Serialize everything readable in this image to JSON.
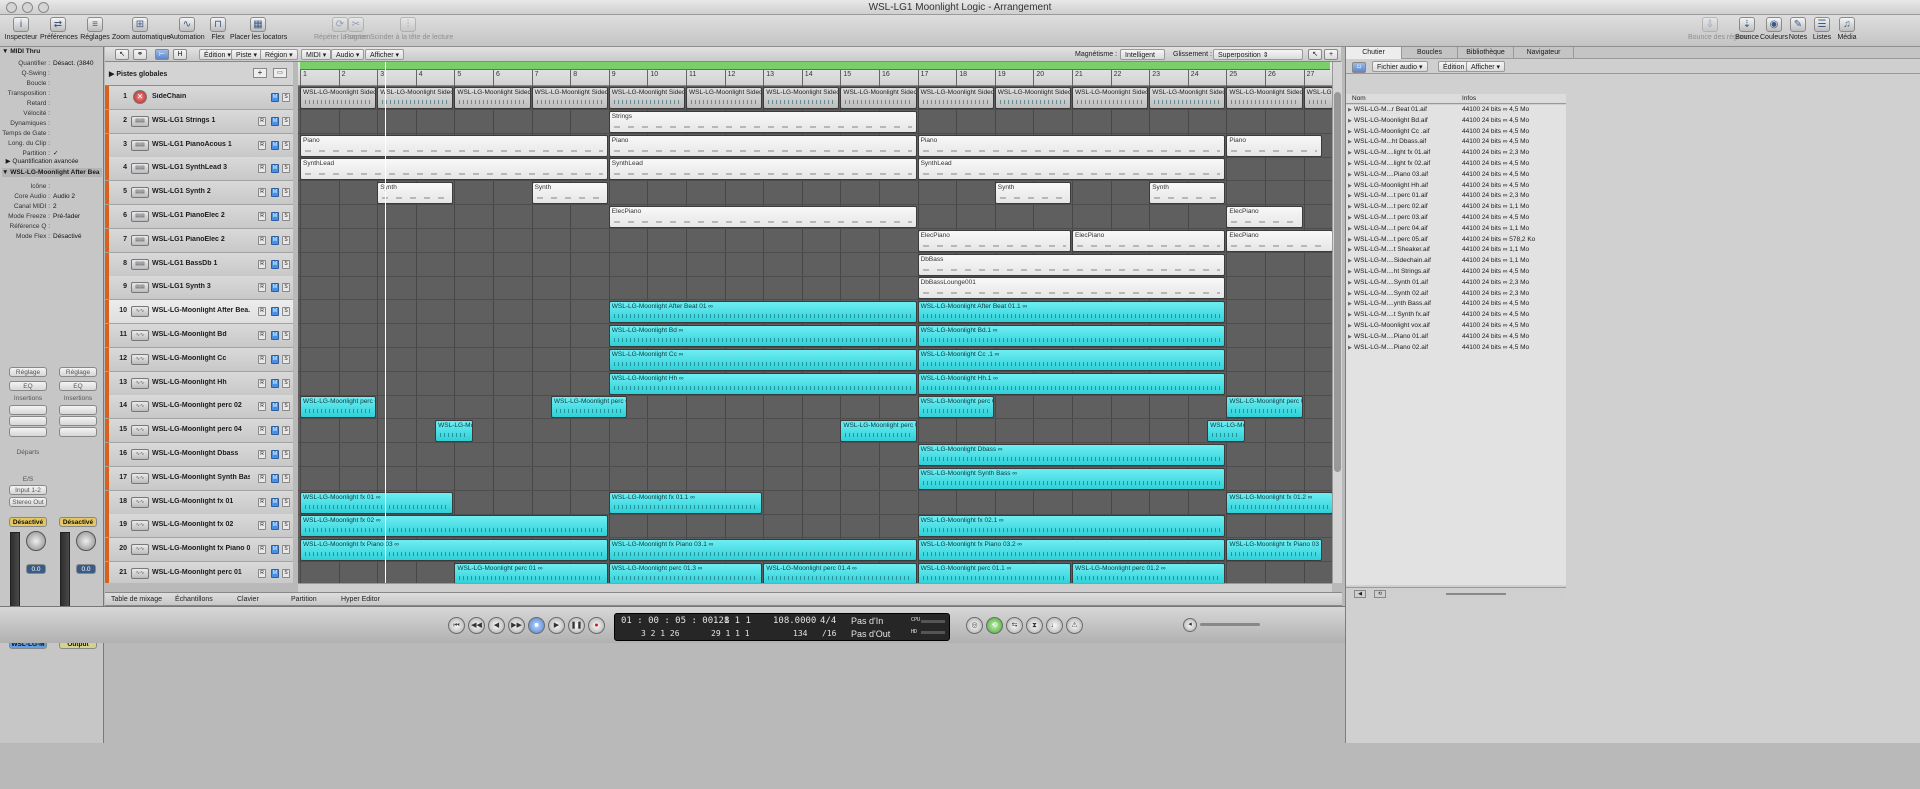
{
  "window_title": "WSL-LG1 Moonlight Logic - Arrangement",
  "toolbar": {
    "left": [
      {
        "label": "Inspecteur",
        "icon": "info-icon",
        "glyph": "i"
      },
      {
        "label": "Préférences",
        "icon": "switch-icon",
        "glyph": "⇄"
      },
      {
        "label": "Réglages",
        "icon": "sliders-icon",
        "glyph": "≡"
      },
      {
        "label": "Zoom automatique",
        "icon": "zoom-icon",
        "glyph": "⊞"
      },
      {
        "label": "Automation",
        "icon": "automation-icon",
        "glyph": "∿"
      },
      {
        "label": "Flex",
        "icon": "flex-icon",
        "glyph": "⊓"
      },
      {
        "label": "Placer les locators",
        "icon": "locators-icon",
        "glyph": "▦"
      },
      {
        "label": "Répéter la section",
        "icon": "repeat-icon",
        "glyph": "⟳",
        "dim": true
      },
      {
        "label": "Rogner",
        "icon": "crop-icon",
        "glyph": "✂",
        "dim": true
      },
      {
        "label": "Scinder à la tête de lecture",
        "icon": "split-icon",
        "glyph": "⫶",
        "dim": true
      }
    ],
    "right": [
      {
        "label": "Bounce des régions",
        "icon": "bounce-regions-icon",
        "glyph": "⇩",
        "dim": true
      },
      {
        "label": "Bounce",
        "icon": "bounce-icon",
        "glyph": "⇣"
      },
      {
        "label": "Couleurs",
        "icon": "colors-icon",
        "glyph": "◉"
      },
      {
        "label": "Notes",
        "icon": "notes-icon",
        "glyph": "✎"
      },
      {
        "label": "Listes",
        "icon": "lists-icon",
        "glyph": "☰"
      },
      {
        "label": "Média",
        "icon": "media-icon",
        "glyph": "♫"
      }
    ]
  },
  "inspector": {
    "midi_thru": "MIDI Thru",
    "params": [
      {
        "k": "Quantifier",
        "v": "Désact. (3840"
      },
      {
        "k": "Q-Swing",
        "v": ""
      },
      {
        "k": "Boucle",
        "v": ""
      },
      {
        "k": "Transposition",
        "v": ""
      },
      {
        "k": "Retard",
        "v": ""
      },
      {
        "k": "Vélocité",
        "v": ""
      },
      {
        "k": "Dynamiques",
        "v": ""
      },
      {
        "k": "Temps de Gate",
        "v": ""
      },
      {
        "k": "Long. du Clip",
        "v": ""
      },
      {
        "k": "Partition",
        "v": "✓"
      }
    ],
    "advanced": "Quantification avancée",
    "track_header": "WSL-LG-Moonlight After Bea",
    "track_params": [
      {
        "k": "Icône",
        "v": ""
      },
      {
        "k": "Core Audio",
        "v": "Audio 2"
      },
      {
        "k": "Canal MIDI",
        "v": "2"
      },
      {
        "k": "Mode Freeze",
        "v": "Pré-fader"
      },
      {
        "k": "Référence Q",
        "v": ""
      },
      {
        "k": "Mode Flex",
        "v": "Désactivé"
      }
    ],
    "strips": [
      {
        "reglage": "Réglage",
        "eq": "EQ",
        "insertions": "Insertions",
        "departs": "Départs",
        "es": "E/S",
        "input": "Input 1-2",
        "output": "Stereo Out",
        "mode": "Désactivé",
        "value": "0.0",
        "name": "WSL-LG-M"
      },
      {
        "reglage": "Réglage",
        "eq": "EQ",
        "insertions": "Insertions",
        "departs": "",
        "es": "",
        "input": "",
        "output": "",
        "mode": "Désactivé",
        "value": "0.0",
        "name": "Output",
        "bnce": "Bnce"
      }
    ]
  },
  "arrange_menu": {
    "items": [
      "Édition",
      "Piste",
      "Région",
      "MIDI",
      "Audio",
      "Afficher"
    ],
    "magnet_label": "Magnétisme :",
    "magnet_value": "Intelligent",
    "drag_label": "Glissement :",
    "drag_value": "Superposition",
    "globals_label": "Pistes globales"
  },
  "ruler": [
    "1",
    "2",
    "3",
    "4",
    "5",
    "6",
    "7",
    "8",
    "9",
    "10",
    "11",
    "12",
    "13",
    "14",
    "15",
    "16",
    "17",
    "18",
    "19",
    "20",
    "21",
    "22",
    "23",
    "24",
    "25",
    "26",
    "27"
  ],
  "tracks": [
    {
      "n": "1",
      "name": "SideChain",
      "type": "side"
    },
    {
      "n": "2",
      "name": "WSL-LG1 Strings 1",
      "type": "midi"
    },
    {
      "n": "3",
      "name": "WSL-LG1 PianoAcous 1",
      "type": "midi"
    },
    {
      "n": "4",
      "name": "WSL-LG1 SynthLead 3",
      "type": "midi"
    },
    {
      "n": "5",
      "name": "WSL-LG1 Synth 2",
      "type": "midi"
    },
    {
      "n": "6",
      "name": "WSL-LG1 PianoElec 2",
      "type": "midi"
    },
    {
      "n": "7",
      "name": "WSL-LG1 PianoElec 2",
      "type": "midi"
    },
    {
      "n": "8",
      "name": "WSL-LG1 BassDb 1",
      "type": "midi"
    },
    {
      "n": "9",
      "name": "WSL-LG1 Synth 3",
      "type": "midi"
    },
    {
      "n": "10",
      "name": "WSL-LG-Moonlight After Bea...",
      "type": "audio",
      "sel": true
    },
    {
      "n": "11",
      "name": "WSL-LG-Moonlight Bd",
      "type": "audio"
    },
    {
      "n": "12",
      "name": "WSL-LG-Moonlight Cc",
      "type": "audio"
    },
    {
      "n": "13",
      "name": "WSL-LG-Moonlight Hh",
      "type": "audio"
    },
    {
      "n": "14",
      "name": "WSL-LG-Moonlight perc 02",
      "type": "audio"
    },
    {
      "n": "15",
      "name": "WSL-LG-Moonlight perc 04",
      "type": "audio"
    },
    {
      "n": "16",
      "name": "WSL-LG-Moonlight Dbass",
      "type": "audio"
    },
    {
      "n": "17",
      "name": "WSL-LG-Moonlight Synth Bass",
      "type": "audio"
    },
    {
      "n": "18",
      "name": "WSL-LG-Moonlight fx 01",
      "type": "audio"
    },
    {
      "n": "19",
      "name": "WSL-LG-Moonlight fx 02",
      "type": "audio"
    },
    {
      "n": "20",
      "name": "WSL-LG-Moonlight fx Piano 03",
      "type": "audio"
    },
    {
      "n": "21",
      "name": "WSL-LG-Moonlight perc 01",
      "type": "audio"
    }
  ],
  "regions": [
    [
      {
        "s": 1,
        "e": 3,
        "t": "WSL-LG-Moonlight Sidech",
        "k": "side"
      },
      {
        "s": 3,
        "e": 5,
        "t": "WSL-LG-Moonlight Sidech",
        "k": "side"
      },
      {
        "s": 5,
        "e": 7,
        "t": "WSL-LG-Moonlight Sidech",
        "k": "side"
      },
      {
        "s": 7,
        "e": 9,
        "t": "WSL-LG-Moonlight Sidech",
        "k": "side"
      },
      {
        "s": 9,
        "e": 11,
        "t": "WSL-LG-Moonlight Sidech",
        "k": "side"
      },
      {
        "s": 11,
        "e": 13,
        "t": "WSL-LG-Moonlight Sidech",
        "k": "side"
      },
      {
        "s": 13,
        "e": 15,
        "t": "WSL-LG-Moonlight Sidech",
        "k": "side"
      },
      {
        "s": 15,
        "e": 17,
        "t": "WSL-LG-Moonlight Sidech",
        "k": "side"
      },
      {
        "s": 17,
        "e": 19,
        "t": "WSL-LG-Moonlight Sidech",
        "k": "side"
      },
      {
        "s": 19,
        "e": 21,
        "t": "WSL-LG-Moonlight Sidech",
        "k": "side"
      },
      {
        "s": 21,
        "e": 23,
        "t": "WSL-LG-Moonlight Sidech",
        "k": "side"
      },
      {
        "s": 23,
        "e": 25,
        "t": "WSL-LG-Moonlight Sidech",
        "k": "side"
      },
      {
        "s": 25,
        "e": 27,
        "t": "WSL-LG-Moonlight Sidech",
        "k": "side"
      },
      {
        "s": 27,
        "e": 27.8,
        "t": "WSL-LG-",
        "k": "side"
      }
    ],
    [
      {
        "s": 9,
        "e": 17,
        "t": "Strings",
        "k": "midi"
      }
    ],
    [
      {
        "s": 1,
        "e": 9,
        "t": "Piano",
        "k": "midi"
      },
      {
        "s": 9,
        "e": 17,
        "t": "Piano",
        "k": "midi"
      },
      {
        "s": 17,
        "e": 25,
        "t": "Piano",
        "k": "midi"
      },
      {
        "s": 25,
        "e": 27.5,
        "t": "Piano",
        "k": "midi"
      }
    ],
    [
      {
        "s": 1,
        "e": 9,
        "t": "SynthLead",
        "k": "midi"
      },
      {
        "s": 9,
        "e": 17,
        "t": "SynthLead",
        "k": "midi"
      },
      {
        "s": 17,
        "e": 25,
        "t": "SynthLead",
        "k": "midi"
      }
    ],
    [
      {
        "s": 3,
        "e": 5,
        "t": "Synth",
        "k": "midi"
      },
      {
        "s": 7,
        "e": 9,
        "t": "Synth",
        "k": "midi"
      },
      {
        "s": 19,
        "e": 21,
        "t": "Synth",
        "k": "midi"
      },
      {
        "s": 23,
        "e": 25,
        "t": "Synth",
        "k": "midi"
      }
    ],
    [
      {
        "s": 9,
        "e": 17,
        "t": "ElecPiano",
        "k": "midi"
      },
      {
        "s": 25,
        "e": 27,
        "t": "ElecPiano",
        "k": "midi"
      }
    ],
    [
      {
        "s": 17,
        "e": 21,
        "t": "ElecPiano",
        "k": "midi"
      },
      {
        "s": 21,
        "e": 25,
        "t": "ElecPiano",
        "k": "midi"
      },
      {
        "s": 25,
        "e": 27.8,
        "t": "ElecPiano",
        "k": "midi"
      }
    ],
    [
      {
        "s": 17,
        "e": 25,
        "t": "DbBass",
        "k": "midi"
      }
    ],
    [
      {
        "s": 17,
        "e": 25,
        "t": "DbBassLounge001",
        "k": "midi"
      }
    ],
    [
      {
        "s": 9,
        "e": 17,
        "t": "WSL-LG-Moonlight After Beat 01 ∞",
        "k": "audio"
      },
      {
        "s": 17,
        "e": 25,
        "t": "WSL-LG-Moonlight After Beat 01.1 ∞",
        "k": "audio"
      }
    ],
    [
      {
        "s": 9,
        "e": 17,
        "t": "WSL-LG-Moonlight Bd ∞",
        "k": "audio"
      },
      {
        "s": 17,
        "e": 25,
        "t": "WSL-LG-Moonlight Bd.1 ∞",
        "k": "audio"
      }
    ],
    [
      {
        "s": 9,
        "e": 17,
        "t": "WSL-LG-Moonlight Cc ∞",
        "k": "audio"
      },
      {
        "s": 17,
        "e": 25,
        "t": "WSL-LG-Moonlight Cc .1 ∞",
        "k": "audio"
      }
    ],
    [
      {
        "s": 9,
        "e": 17,
        "t": "WSL-LG-Moonlight Hh ∞",
        "k": "audio"
      },
      {
        "s": 17,
        "e": 25,
        "t": "WSL-LG-Moonlight Hh.1 ∞",
        "k": "audio"
      }
    ],
    [
      {
        "s": 1,
        "e": 3,
        "t": "WSL-LG-Moonlight perc 0",
        "k": "audio"
      },
      {
        "s": 7.5,
        "e": 9.5,
        "t": "WSL-LG-Moonlight perc 0",
        "k": "audio"
      },
      {
        "s": 17,
        "e": 19,
        "t": "WSL-LG-Moonlight perc 0",
        "k": "audio"
      },
      {
        "s": 25,
        "e": 27,
        "t": "WSL-LG-Moonlight perc 0",
        "k": "audio"
      }
    ],
    [
      {
        "s": 4.5,
        "e": 5.5,
        "t": "WSL-LG-Mo",
        "k": "audio"
      },
      {
        "s": 15,
        "e": 17,
        "t": "WSL-LG-Moonlight perc 0",
        "k": "audio"
      },
      {
        "s": 24.5,
        "e": 25.5,
        "t": "WSL-LG-Mo",
        "k": "audio"
      }
    ],
    [
      {
        "s": 17,
        "e": 25,
        "t": "WSL-LG-Moonlight Dbass ∞",
        "k": "audio"
      }
    ],
    [
      {
        "s": 17,
        "e": 25,
        "t": "WSL-LG-Moonlight Synth Bass ∞",
        "k": "audio"
      }
    ],
    [
      {
        "s": 1,
        "e": 5,
        "t": "WSL-LG-Moonlight fx 01 ∞",
        "k": "audio"
      },
      {
        "s": 9,
        "e": 13,
        "t": "WSL-LG-Moonlight fx 01.1 ∞",
        "k": "audio"
      },
      {
        "s": 25,
        "e": 27.8,
        "t": "WSL-LG-Moonlight fx 01.2 ∞",
        "k": "audio"
      }
    ],
    [
      {
        "s": 1,
        "e": 9,
        "t": "WSL-LG-Moonlight fx 02 ∞",
        "k": "audio"
      },
      {
        "s": 17,
        "e": 25,
        "t": "WSL-LG-Moonlight fx 02.1 ∞",
        "k": "audio"
      }
    ],
    [
      {
        "s": 1,
        "e": 9,
        "t": "WSL-LG-Moonlight fx Piano 03 ∞",
        "k": "audio"
      },
      {
        "s": 9,
        "e": 17,
        "t": "WSL-LG-Moonlight fx Piano 03.1 ∞",
        "k": "audio"
      },
      {
        "s": 17,
        "e": 25,
        "t": "WSL-LG-Moonlight fx Piano 03.2 ∞",
        "k": "audio"
      },
      {
        "s": 25,
        "e": 27.5,
        "t": "WSL-LG-Moonlight fx Piano 03",
        "k": "audio"
      }
    ],
    [
      {
        "s": 5,
        "e": 9,
        "t": "WSL-LG-Moonlight perc 01 ∞",
        "k": "audio"
      },
      {
        "s": 9,
        "e": 13,
        "t": "WSL-LG-Moonlight perc 01.3 ∞",
        "k": "audio"
      },
      {
        "s": 13,
        "e": 17,
        "t": "WSL-LG-Moonlight perc 01.4 ∞",
        "k": "audio"
      },
      {
        "s": 17,
        "e": 21,
        "t": "WSL-LG-Moonlight perc 01.1 ∞",
        "k": "audio"
      },
      {
        "s": 21,
        "e": 25,
        "t": "WSL-LG-Moonlight perc 01.2 ∞",
        "k": "audio"
      }
    ]
  ],
  "bottom_tabs": [
    "Table de mixage",
    "Échantillons",
    "Clavier",
    "Partition",
    "Hyper Editor"
  ],
  "transport": {
    "smpte": "01 : 00 : 05 : 00.28",
    "smpte_sub": "3   2   1   26",
    "bars": "1   1   1   1",
    "bars_sub": "29   1   1   1",
    "tempo": "108.0000",
    "tempo_sub": "134",
    "sig": "4/4",
    "sig_sub": "/16",
    "in": "Pas d'In",
    "out": "Pas d'Out",
    "cpu": "CPU",
    "hd": "HD",
    "buttons": [
      "goto-start",
      "rewind",
      "rewind-fast",
      "forward-fast",
      "stop",
      "play",
      "pause",
      "record"
    ],
    "glyphs": [
      "⏮",
      "◀◀",
      "◀",
      "▶▶",
      "■",
      "▶",
      "❚❚",
      "●"
    ]
  },
  "media": {
    "tabs": [
      "Chutier",
      "Boucles",
      "Bibliothèque",
      "Navigateur"
    ],
    "menu": [
      "Fichier audio",
      "Édition",
      "Afficher"
    ],
    "col_name": "Nom",
    "col_info": "Infos",
    "files": [
      {
        "n": "WSL-LG-M...r Beat 01.aif",
        "i": "44100  24 bits  ∞  4,5 Mo"
      },
      {
        "n": "WSL-LG-Moonlight Bd.aif",
        "i": "44100  24 bits  ∞  4,5 Mo"
      },
      {
        "n": "WSL-LG-Moonlight Cc .aif",
        "i": "44100  24 bits  ∞  4,5 Mo"
      },
      {
        "n": "WSL-LG-M...ht Dbass.aif",
        "i": "44100  24 bits  ∞  4,5 Mo"
      },
      {
        "n": "WSL-LG-M....light fx 01.aif",
        "i": "44100  24 bits  ∞  2,3 Mo"
      },
      {
        "n": "WSL-LG-M....light fx 02.aif",
        "i": "44100  24 bits  ∞  4,5 Mo"
      },
      {
        "n": "WSL-LG-M....Piano 03.aif",
        "i": "44100  24 bits  ∞  4,5 Mo"
      },
      {
        "n": "WSL-LG-Moonlight Hh.aif",
        "i": "44100  24 bits  ∞  4,5 Mo"
      },
      {
        "n": "WSL-LG-M....t perc 01.aif",
        "i": "44100  24 bits  ∞  2,3 Mo"
      },
      {
        "n": "WSL-LG-M....t perc 02.aif",
        "i": "44100  24 bits  ∞  1,1 Mo"
      },
      {
        "n": "WSL-LG-M....t perc 03.aif",
        "i": "44100  24 bits  ∞  4,5 Mo"
      },
      {
        "n": "WSL-LG-M....t perc 04.aif",
        "i": "44100  24 bits  ∞  1,1 Mo"
      },
      {
        "n": "WSL-LG-M....t perc 05.aif",
        "i": "44100  24 bits  ∞  578,2 Ko"
      },
      {
        "n": "WSL-LG-M....t Sheaker.aif",
        "i": "44100  24 bits  ∞  1,1 Mo"
      },
      {
        "n": "WSL-LG-M....Sidechain.aif",
        "i": "44100  24 bits  ∞  1,1 Mo"
      },
      {
        "n": "WSL-LG-M....ht Strings.aif",
        "i": "44100  24 bits  ∞  4,5 Mo"
      },
      {
        "n": "WSL-LG-M....Synth 01.aif",
        "i": "44100  24 bits  ∞  2,3 Mo"
      },
      {
        "n": "WSL-LG-M....Synth 02.aif",
        "i": "44100  24 bits  ∞  2,3 Mo"
      },
      {
        "n": "WSL-LG-M....ynth Bass.aif",
        "i": "44100  24 bits  ∞  4,5 Mo"
      },
      {
        "n": "WSL-LG-M....t Synth fx.aif",
        "i": "44100  24 bits  ∞  4,5 Mo"
      },
      {
        "n": "WSL-LG-Moonlight vox.aif",
        "i": "44100  24 bits  ∞  4,5 Mo"
      },
      {
        "n": "WSL-LG-M....Piano 01.aif",
        "i": "44100  24 bits  ∞  4,5 Mo"
      },
      {
        "n": "WSL-LG-M....Piano 02.aif",
        "i": "44100  24 bits  ∞  4,5 Mo"
      }
    ]
  },
  "colors": {
    "track_bar": "#d6621e",
    "audio_region": "#2fd0d8",
    "midi_region": "#f2f2f2",
    "cycle": "#7bcf6a"
  }
}
